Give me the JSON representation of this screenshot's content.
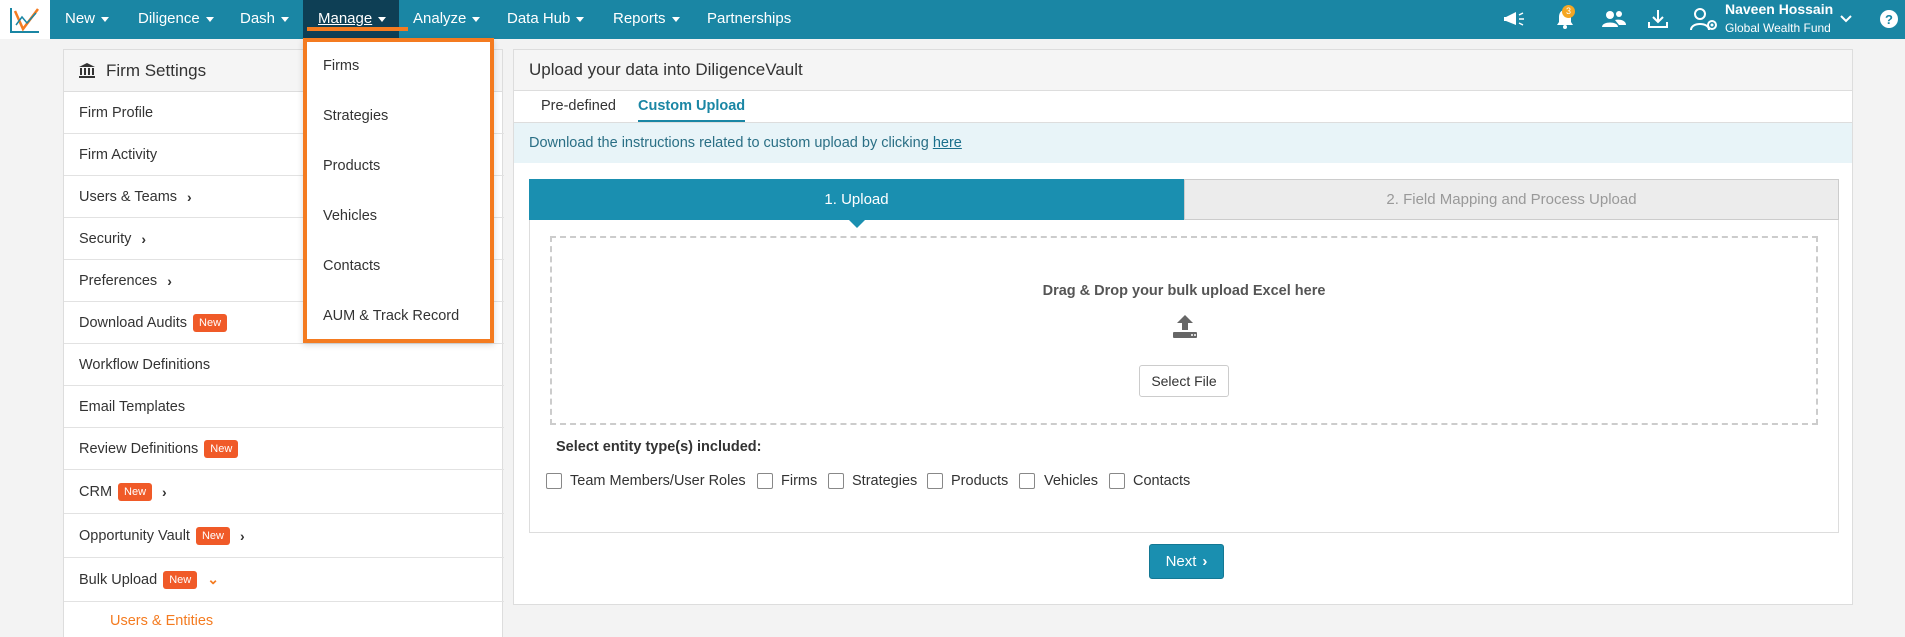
{
  "nav": {
    "items": [
      {
        "label": "New"
      },
      {
        "label": "Diligence"
      },
      {
        "label": "Dash"
      },
      {
        "label": "Manage"
      },
      {
        "label": "Analyze"
      },
      {
        "label": "Data Hub"
      },
      {
        "label": "Reports"
      },
      {
        "label": "Partnerships"
      }
    ],
    "active_item": "Manage",
    "notification_count": "3",
    "user": {
      "name": "Naveen Hossain",
      "org": "Global Wealth Fund"
    },
    "icons": [
      "announcement-icon",
      "bell-icon",
      "users-icon",
      "download-icon",
      "user-gear-icon",
      "chevron-down-icon",
      "help-icon"
    ]
  },
  "manage_menu": {
    "items": [
      "Firms",
      "Strategies",
      "Products",
      "Vehicles",
      "Contacts",
      "AUM & Track Record"
    ]
  },
  "sidebar": {
    "title": "Firm Settings",
    "new_label": "New",
    "items": [
      {
        "label": "Firm Profile"
      },
      {
        "label": "Firm Activity"
      },
      {
        "label": "Users & Teams"
      },
      {
        "label": "Security"
      },
      {
        "label": "Preferences"
      },
      {
        "label": "Download Audits"
      },
      {
        "label": "Workflow Definitions"
      },
      {
        "label": "Email Templates"
      },
      {
        "label": "Review Definitions"
      },
      {
        "label": "CRM"
      },
      {
        "label": "Opportunity Vault"
      },
      {
        "label": "Bulk Upload"
      }
    ],
    "sub_item": "Users & Entities"
  },
  "main": {
    "title": "Upload your data into DiligenceVault",
    "tabs": [
      {
        "label": "Pre-defined"
      },
      {
        "label": "Custom Upload"
      }
    ],
    "active_tab": "Custom Upload",
    "info_text": "Download the instructions related to custom upload by clicking",
    "info_link": "here",
    "steps": [
      "1. Upload",
      "2. Field Mapping and Process Upload"
    ],
    "dropzone_text": "Drag & Drop your bulk upload Excel here",
    "select_file_label": "Select File",
    "entity_label": "Select entity type(s) included:",
    "entities": [
      "Team Members/User Roles",
      "Firms",
      "Strategies",
      "Products",
      "Vehicles",
      "Contacts"
    ],
    "next_label": "Next"
  },
  "colors": {
    "primary": "#1a86a4",
    "accent": "#f47b20",
    "badge": "#f05a28"
  }
}
